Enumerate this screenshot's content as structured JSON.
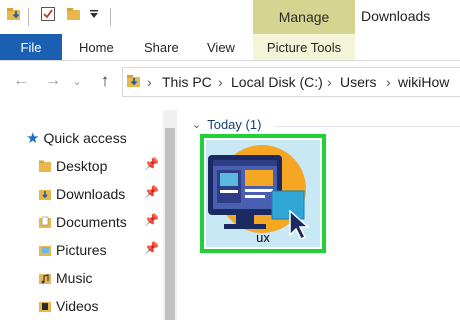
{
  "titlebar": {
    "manage_tab": "Manage",
    "window_title": "Downloads"
  },
  "ribbon": {
    "tabs": [
      {
        "label": "File"
      },
      {
        "label": "Home"
      },
      {
        "label": "Share"
      },
      {
        "label": "View"
      },
      {
        "label": "Picture Tools"
      }
    ]
  },
  "address_bar": {
    "crumbs": [
      "This PC",
      "Local Disk (C:)",
      "Users",
      "wikiHow"
    ]
  },
  "nav_pane": {
    "quick_access": "Quick access",
    "items": [
      {
        "label": "Desktop",
        "icon": "folder-icon",
        "pinned": true
      },
      {
        "label": "Downloads",
        "icon": "downloads-folder-icon",
        "pinned": true
      },
      {
        "label": "Documents",
        "icon": "documents-folder-icon",
        "pinned": true
      },
      {
        "label": "Pictures",
        "icon": "pictures-folder-icon",
        "pinned": true
      },
      {
        "label": "Music",
        "icon": "music-folder-icon",
        "pinned": false
      },
      {
        "label": "Videos",
        "icon": "videos-folder-icon",
        "pinned": false
      }
    ]
  },
  "content": {
    "group_label": "Today (1)",
    "file": {
      "name": "ux",
      "selected": true
    }
  },
  "colors": {
    "file_tab": "#1b5fb3",
    "manage_tab": "#d5d592",
    "selection_border": "#22d13a",
    "quick_access_star": "#1f6fc5",
    "folder": "#e8b84a"
  }
}
